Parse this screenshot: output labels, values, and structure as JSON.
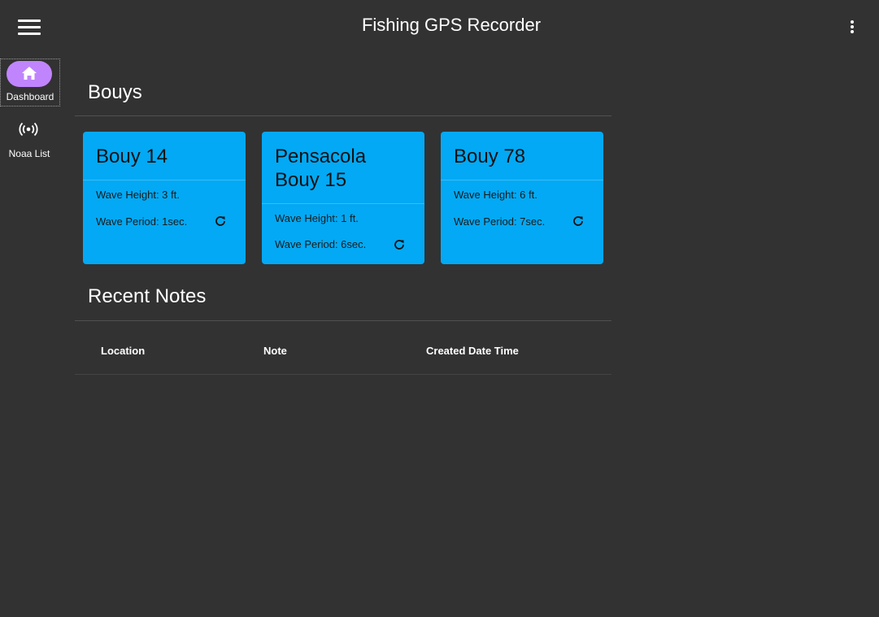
{
  "app": {
    "title": "Fishing GPS Recorder",
    "colors": {
      "background": "#323232",
      "card": "#03a9f4",
      "nav_active_pill": "#c085fd"
    }
  },
  "topbar": {
    "menu_icon": "hamburger-menu-icon",
    "more_icon": "more-vertical-icon"
  },
  "nav": {
    "items": [
      {
        "label": "Dashboard",
        "icon": "home-icon",
        "active": true
      },
      {
        "label": "Noaa List",
        "icon": "broadcast-icon",
        "active": false
      }
    ]
  },
  "bouys": {
    "heading": "Bouys",
    "cards": [
      {
        "title": "Bouy 14",
        "wave_height": "Wave Height: 3 ft.",
        "wave_period": "Wave Period: 1sec."
      },
      {
        "title": "Pensacola Bouy 15",
        "wave_height": "Wave Height: 1 ft.",
        "wave_period": "Wave Period: 6sec."
      },
      {
        "title": "Bouy 78",
        "wave_height": "Wave Height: 6 ft.",
        "wave_period": "Wave Period: 7sec."
      }
    ],
    "refresh_icon": "refresh-icon"
  },
  "notes": {
    "heading": "Recent Notes",
    "columns": [
      "Location",
      "Note",
      "Created Date Time"
    ],
    "rows": []
  }
}
